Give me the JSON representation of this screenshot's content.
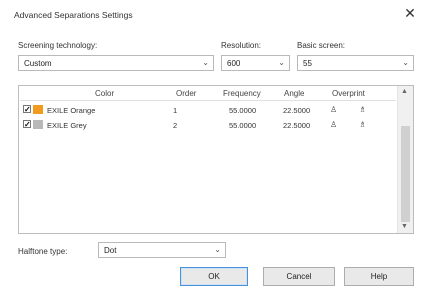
{
  "window": {
    "title": "Advanced Separations Settings"
  },
  "screening": {
    "label": "Screening technology:",
    "value": "Custom"
  },
  "resolution": {
    "label": "Resolution:",
    "value": "600"
  },
  "basic_screen": {
    "label": "Basic screen:",
    "value": "55"
  },
  "table": {
    "headers": {
      "color": "Color",
      "order": "Order",
      "frequency": "Frequency",
      "angle": "Angle",
      "overprint": "Overprint"
    },
    "rows": [
      {
        "checked": true,
        "swatch": "#f29a1d",
        "name": "EXILE Orange",
        "order": "1",
        "frequency": "55.0000",
        "angle": "22.5000"
      },
      {
        "checked": true,
        "swatch": "#b8b8b8",
        "name": "EXILE Grey",
        "order": "2",
        "frequency": "55.0000",
        "angle": "22.5000"
      }
    ]
  },
  "halftone": {
    "label": "Halftone type:",
    "value": "Dot"
  },
  "buttons": {
    "ok": "OK",
    "cancel": "Cancel",
    "help": "Help"
  },
  "icons": {
    "close": "close-icon",
    "overprint_fill": "overprint-fill-icon",
    "overprint_outline": "overprint-outline-icon"
  }
}
